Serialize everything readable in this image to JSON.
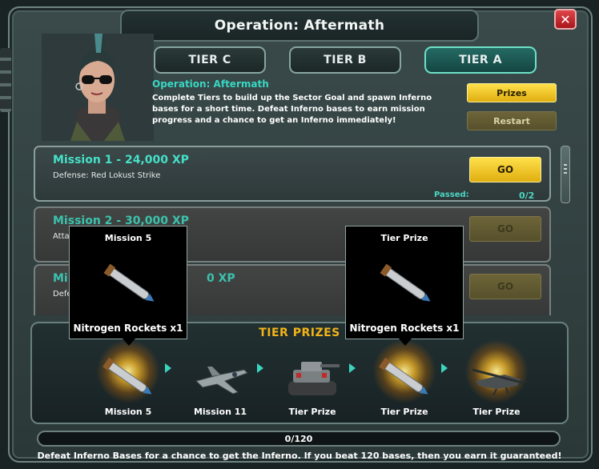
{
  "window": {
    "title": "Operation: Aftermath",
    "close_glyph": "✕"
  },
  "tabs": [
    {
      "label": "TIER C",
      "active": false
    },
    {
      "label": "TIER B",
      "active": false
    },
    {
      "label": "TIER A",
      "active": true
    }
  ],
  "operation": {
    "title": "Operation: Aftermath",
    "description": "Complete Tiers to build up the Sector Goal and spawn Inferno bases for a short time. Defeat Inferno bases to earn mission progress and a chance to get an Inferno immediately!"
  },
  "buttons": {
    "prizes": "Prizes",
    "restart": "Restart",
    "go": "GO"
  },
  "missions": [
    {
      "title": "Mission 1 - 24,000 XP",
      "subtitle": "Defense: Red Lokust Strike",
      "passed_label": "Passed:",
      "passed_value": "0/2",
      "enabled": true
    },
    {
      "title": "Mission 2 - 30,000 XP",
      "subtitle": "Attac",
      "enabled": false
    },
    {
      "title": "Mi",
      "title_tail": "0 XP",
      "subtitle": "Defe",
      "enabled": false
    }
  ],
  "tier_prizes": {
    "header": "TIER PRIZES",
    "items": [
      {
        "label": "Mission 5",
        "icon": "rocket-icon"
      },
      {
        "label": "Mission 11",
        "icon": "jet-icon"
      },
      {
        "label": "Tier Prize",
        "icon": "tank-icon"
      },
      {
        "label": "Tier Prize",
        "icon": "rocket-icon"
      },
      {
        "label": "Tier Prize",
        "icon": "helicopter-icon"
      }
    ]
  },
  "tooltips": [
    {
      "title": "Mission 5",
      "item": "Nitrogen Rockets x1"
    },
    {
      "title": "Tier Prize",
      "item": "Nitrogen Rockets x1"
    }
  ],
  "progress": {
    "text": "0/120",
    "current": 0,
    "total": 120
  },
  "footer": "Defeat Inferno Bases for a chance to get the Inferno. If you beat 120 bases, then you earn it guaranteed!",
  "colors": {
    "accent": "#46e0c8",
    "gold": "#f2b418",
    "button_yellow": "#ffd22e",
    "close_red": "#c8242a"
  }
}
